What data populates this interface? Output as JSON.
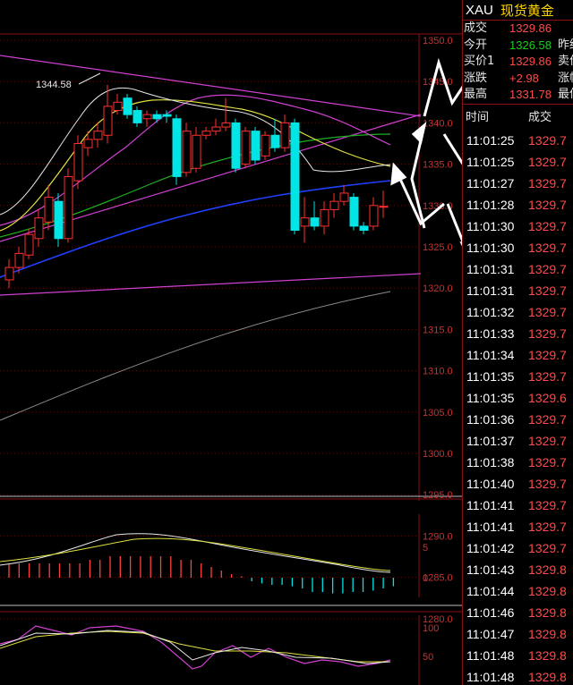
{
  "chart": {
    "price_axis": [
      "1350.0",
      "1345.0",
      "1340.0",
      "1335.0",
      "1330.0",
      "1325.0",
      "1320.0",
      "1315.0",
      "1310.0",
      "1305.0",
      "1300.0",
      "1295.0",
      "1290.0",
      "1285.0",
      "1280.0"
    ],
    "high_annotation": "1344.58",
    "macd_axis": [
      "5",
      "0"
    ],
    "kdj_axis": [
      "100",
      "50"
    ]
  },
  "quote": {
    "symbol": "XAU",
    "name": "现货黄金",
    "rows": [
      {
        "label": "成交",
        "value": "1329.86",
        "value_color": "#ff4a4a",
        "label2": ""
      },
      {
        "label": "今开",
        "value": "1326.58",
        "value_color": "#18d018",
        "label2": "昨结"
      },
      {
        "label": "买价1",
        "value": "1329.86",
        "value_color": "#ff4a4a",
        "label2": "卖价"
      },
      {
        "label": "涨跌",
        "value": "+2.98",
        "value_color": "#ff4a4a",
        "label2": "涨幅"
      },
      {
        "label": "最高",
        "value": "1331.78",
        "value_color": "#ff4a4a",
        "label2": "最低"
      }
    ]
  },
  "ticks": {
    "header_time": "时间",
    "header_price": "成交",
    "rows": [
      {
        "time": "11:01:25",
        "price": "1329.7"
      },
      {
        "time": "11:01:25",
        "price": "1329.7"
      },
      {
        "time": "11:01:27",
        "price": "1329.7"
      },
      {
        "time": "11:01:28",
        "price": "1329.7"
      },
      {
        "time": "11:01:30",
        "price": "1329.7"
      },
      {
        "time": "11:01:30",
        "price": "1329.7"
      },
      {
        "time": "11:01:31",
        "price": "1329.7"
      },
      {
        "time": "11:01:31",
        "price": "1329.7"
      },
      {
        "time": "11:01:32",
        "price": "1329.7"
      },
      {
        "time": "11:01:33",
        "price": "1329.7"
      },
      {
        "time": "11:01:34",
        "price": "1329.7"
      },
      {
        "time": "11:01:35",
        "price": "1329.7"
      },
      {
        "time": "11:01:35",
        "price": "1329.6"
      },
      {
        "time": "11:01:36",
        "price": "1329.7"
      },
      {
        "time": "11:01:37",
        "price": "1329.7"
      },
      {
        "time": "11:01:38",
        "price": "1329.7"
      },
      {
        "time": "11:01:40",
        "price": "1329.7"
      },
      {
        "time": "11:01:41",
        "price": "1329.7"
      },
      {
        "time": "11:01:41",
        "price": "1329.7"
      },
      {
        "time": "11:01:42",
        "price": "1329.7"
      },
      {
        "time": "11:01:43",
        "price": "1329.8"
      },
      {
        "time": "11:01:44",
        "price": "1329.8"
      },
      {
        "time": "11:01:46",
        "price": "1329.8"
      },
      {
        "time": "11:01:47",
        "price": "1329.8"
      },
      {
        "time": "11:01:48",
        "price": "1329.8"
      },
      {
        "time": "11:01:48",
        "price": "1329.8"
      }
    ]
  },
  "candles": [
    {
      "o": 1321.0,
      "c": 1322.5,
      "h": 1323.5,
      "l": 1320.0
    },
    {
      "o": 1322.5,
      "c": 1324.2,
      "h": 1325.0,
      "l": 1321.8
    },
    {
      "o": 1324.0,
      "c": 1326.5,
      "h": 1327.2,
      "l": 1323.5
    },
    {
      "o": 1326.0,
      "c": 1328.5,
      "h": 1329.5,
      "l": 1325.0
    },
    {
      "o": 1328.0,
      "c": 1331.0,
      "h": 1332.5,
      "l": 1327.0
    },
    {
      "o": 1330.5,
      "c": 1326.0,
      "h": 1331.5,
      "l": 1325.0
    },
    {
      "o": 1326.0,
      "c": 1333.5,
      "h": 1334.5,
      "l": 1325.5
    },
    {
      "o": 1333.0,
      "c": 1337.5,
      "h": 1338.5,
      "l": 1332.0
    },
    {
      "o": 1337.0,
      "c": 1338.0,
      "h": 1339.0,
      "l": 1336.0
    },
    {
      "o": 1338.0,
      "c": 1339.0,
      "h": 1340.0,
      "l": 1337.0
    },
    {
      "o": 1338.5,
      "c": 1342.0,
      "h": 1344.6,
      "l": 1337.5
    },
    {
      "o": 1341.5,
      "c": 1342.5,
      "h": 1343.5,
      "l": 1341.0
    },
    {
      "o": 1343.0,
      "c": 1341.0,
      "h": 1343.5,
      "l": 1340.5
    },
    {
      "o": 1341.5,
      "c": 1340.0,
      "h": 1342.0,
      "l": 1339.5
    },
    {
      "o": 1340.5,
      "c": 1341.0,
      "h": 1341.5,
      "l": 1339.5
    },
    {
      "o": 1341.0,
      "c": 1340.5,
      "h": 1341.5,
      "l": 1340.0
    },
    {
      "o": 1341.0,
      "c": 1340.8,
      "h": 1341.5,
      "l": 1340.0
    },
    {
      "o": 1340.5,
      "c": 1333.5,
      "h": 1341.0,
      "l": 1332.5
    },
    {
      "o": 1334.0,
      "c": 1339.0,
      "h": 1340.0,
      "l": 1333.5
    },
    {
      "o": 1334.5,
      "c": 1338.5,
      "h": 1339.5,
      "l": 1334.0
    },
    {
      "o": 1338.5,
      "c": 1339.0,
      "h": 1339.5,
      "l": 1338.0
    },
    {
      "o": 1339.0,
      "c": 1339.5,
      "h": 1340.5,
      "l": 1338.5
    },
    {
      "o": 1339.5,
      "c": 1340.0,
      "h": 1343.0,
      "l": 1339.0
    },
    {
      "o": 1340.0,
      "c": 1334.5,
      "h": 1340.5,
      "l": 1334.0
    },
    {
      "o": 1335.0,
      "c": 1339.0,
      "h": 1339.5,
      "l": 1334.5
    },
    {
      "o": 1339.0,
      "c": 1335.5,
      "h": 1339.5,
      "l": 1335.0
    },
    {
      "o": 1336.0,
      "c": 1338.5,
      "h": 1339.0,
      "l": 1335.5
    },
    {
      "o": 1338.5,
      "c": 1337.0,
      "h": 1340.5,
      "l": 1336.5
    },
    {
      "o": 1337.0,
      "c": 1340.0,
      "h": 1341.0,
      "l": 1336.5
    },
    {
      "o": 1340.0,
      "c": 1327.0,
      "h": 1340.5,
      "l": 1326.5
    },
    {
      "o": 1327.5,
      "c": 1328.5,
      "h": 1331.0,
      "l": 1325.5
    },
    {
      "o": 1328.5,
      "c": 1327.5,
      "h": 1330.5,
      "l": 1327.0
    },
    {
      "o": 1327.5,
      "c": 1329.5,
      "h": 1330.5,
      "l": 1326.5
    },
    {
      "o": 1329.5,
      "c": 1330.5,
      "h": 1331.5,
      "l": 1328.5
    },
    {
      "o": 1330.5,
      "c": 1331.5,
      "h": 1332.5,
      "l": 1330.0
    },
    {
      "o": 1331.0,
      "c": 1327.5,
      "h": 1331.5,
      "l": 1327.0
    },
    {
      "o": 1327.5,
      "c": 1327.0,
      "h": 1328.0,
      "l": 1326.5
    },
    {
      "o": 1327.5,
      "c": 1330.0,
      "h": 1331.0,
      "l": 1327.0
    },
    {
      "o": 1329.8,
      "c": 1329.9,
      "h": 1331.8,
      "l": 1328.5
    }
  ],
  "macd_hist": [
    2,
    2,
    2,
    2,
    2,
    2,
    2,
    2,
    2.5,
    2.5,
    3,
    3,
    3,
    3,
    3,
    3,
    3,
    2.5,
    2.5,
    2,
    1.5,
    1,
    0.5,
    0.2,
    -0.5,
    -0.8,
    -1,
    -1,
    -1.2,
    -1.5,
    -2,
    -2,
    -2.2,
    -2.2,
    -2,
    -2,
    -1.8,
    -1.5,
    -1.2
  ]
}
